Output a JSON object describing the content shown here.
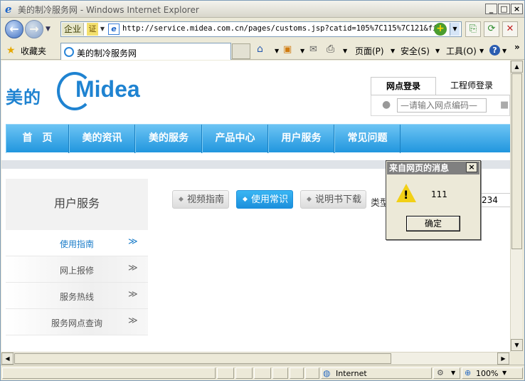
{
  "window": {
    "title": "美的制冷服务网 - Windows Internet Explorer"
  },
  "address_bar": {
    "zone_label": "企业",
    "cert_label": "证",
    "url": "http://service.midea.com.cn/pages/customs.jsp?catid=105%7C115%7C121&fio="
  },
  "favorites_bar": {
    "favorites_label": "收藏夹",
    "tab_title": "美的制冷服务网"
  },
  "command_bar": {
    "page_label": "页面(P)",
    "safety_label": "安全(S)",
    "tools_label": "工具(O)",
    "help_label": "?"
  },
  "site": {
    "logo_cn": "美的",
    "logo_en": "Midea",
    "login_tabs": [
      "网点登录",
      "工程师登录"
    ],
    "login_placeholder": "—请输入网点编码—",
    "nav": [
      "首　页",
      "美的资讯",
      "美的服务",
      "产品中心",
      "用户服务",
      "常见问题"
    ],
    "sidebar_title": "用户服务",
    "sidebar_items": [
      "使用指南",
      "网上报修",
      "服务热线",
      "服务网点查询"
    ],
    "sidebar_chevron": "≫",
    "subtabs": [
      "视频指南",
      "使用常识",
      "说明书下载"
    ],
    "type_label": "类型",
    "number_value": "234"
  },
  "dialog": {
    "title": "来自网页的消息",
    "message": "111",
    "ok_label": "确定"
  },
  "status_bar": {
    "zone": "Internet",
    "zoom": "100%"
  }
}
